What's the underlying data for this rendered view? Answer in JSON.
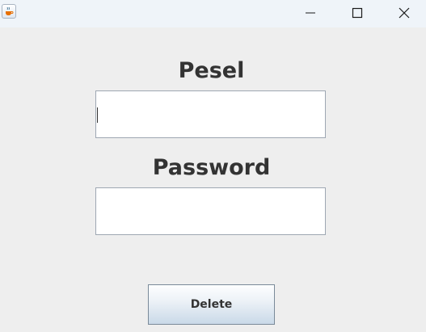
{
  "window": {
    "icon": "java-coffee-icon",
    "controls": [
      "minimize-icon",
      "maximize-icon",
      "close-icon"
    ]
  },
  "form": {
    "pesel_label": "Pesel",
    "pesel_value": "",
    "password_label": "Password",
    "password_value": "",
    "delete_label": "Delete"
  }
}
